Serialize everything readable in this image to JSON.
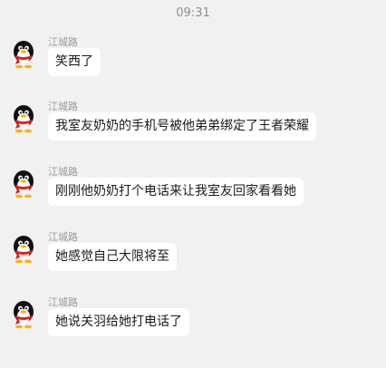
{
  "header": {
    "time": "09:31"
  },
  "messages": [
    {
      "sender": "江城路",
      "text": "笑西了"
    },
    {
      "sender": "江城路",
      "text": "我室友奶奶的手机号被他弟弟绑定了王者荣耀"
    },
    {
      "sender": "江城路",
      "text": "刚刚他奶奶打个电话来让我室友回家看看她"
    },
    {
      "sender": "江城路",
      "text": "她感觉自己大限将至"
    },
    {
      "sender": "江城路",
      "text": "她说关羽给她打电话了"
    }
  ],
  "avatar_icon": "qq-penguin-icon",
  "colors": {
    "background": "#f1f1f1",
    "bubble": "#ffffff",
    "scarf": "#e02020"
  }
}
